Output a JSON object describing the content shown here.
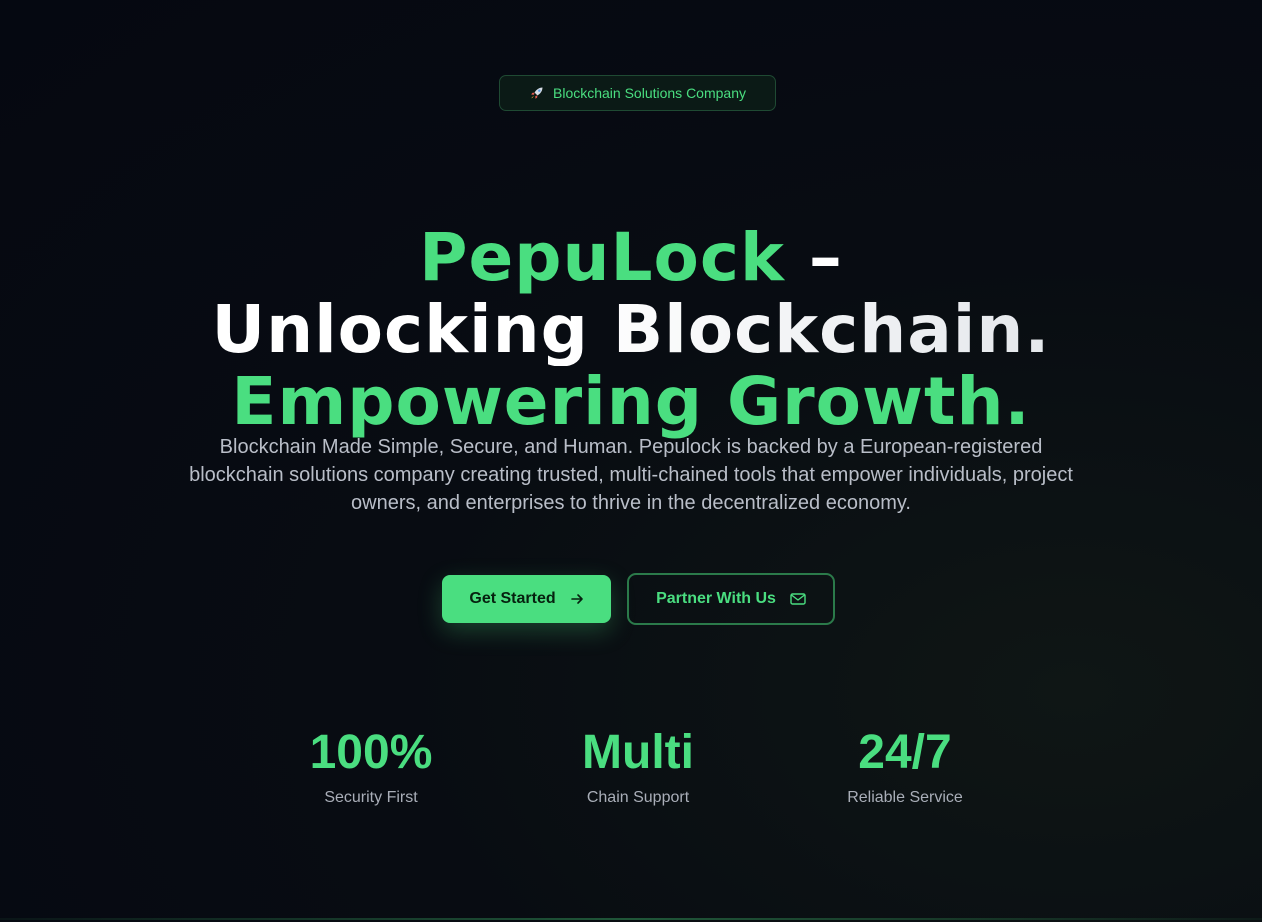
{
  "badge": {
    "icon": "rocket-icon",
    "text": "Blockchain Solutions Company"
  },
  "headline": {
    "line1_brand": "PepuLock",
    "line1_dash": " –",
    "line2": "Unlocking Blockchain.",
    "line3": "Empowering Growth."
  },
  "description": "Blockchain Made Simple, Secure, and Human. Pepulock is backed by a European-registered blockchain solutions company creating trusted, multi-chained tools that empower individuals, project owners, and enterprises to thrive in the decentralized economy.",
  "buttons": {
    "primary": {
      "label": "Get Started",
      "icon": "arrow-right-icon"
    },
    "secondary": {
      "label": "Partner With Us",
      "icon": "mail-icon"
    }
  },
  "stats": [
    {
      "value": "100%",
      "label": "Security First"
    },
    {
      "value": "Multi",
      "label": "Chain Support"
    },
    {
      "value": "24/7",
      "label": "Reliable Service"
    }
  ],
  "colors": {
    "accent": "#4ade80",
    "background": "#050811",
    "text_muted": "#b9bec8"
  }
}
